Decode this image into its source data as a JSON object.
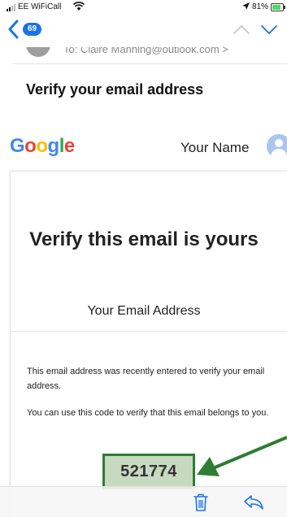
{
  "status_bar": {
    "carrier": "EE WiFiCall",
    "location_icon": "location-arrow-icon",
    "battery": "81%",
    "battery_level": 0.81
  },
  "nav": {
    "back_icon": "chevron-left-icon",
    "unread_count": "69",
    "prev_icon": "chevron-up-icon",
    "next_icon": "chevron-down-icon"
  },
  "message": {
    "to_line": "To: Claire Manning@outlook.com >",
    "subject": "Verify your email address"
  },
  "email_body": {
    "logo": "Google",
    "account_name": "Your Name",
    "title": "Verify this email is yours",
    "email_address": "Your Email Address",
    "paragraph_1": "This email address was recently entered to verify your email address.",
    "paragraph_2": "You can use this code to verify that this email belongs to you.",
    "code": "521774"
  },
  "annotation": {
    "highlight_color": "#2e7d32",
    "highlight_fill": "#c7d9bf"
  },
  "toolbar": {
    "trash_icon": "trash-icon",
    "reply_icon": "reply-icon"
  },
  "colors": {
    "accent": "#1a73e8",
    "google_blue": "#4285F4",
    "google_red": "#EA4335",
    "google_yellow": "#FBBC05",
    "google_green": "#34A853"
  }
}
